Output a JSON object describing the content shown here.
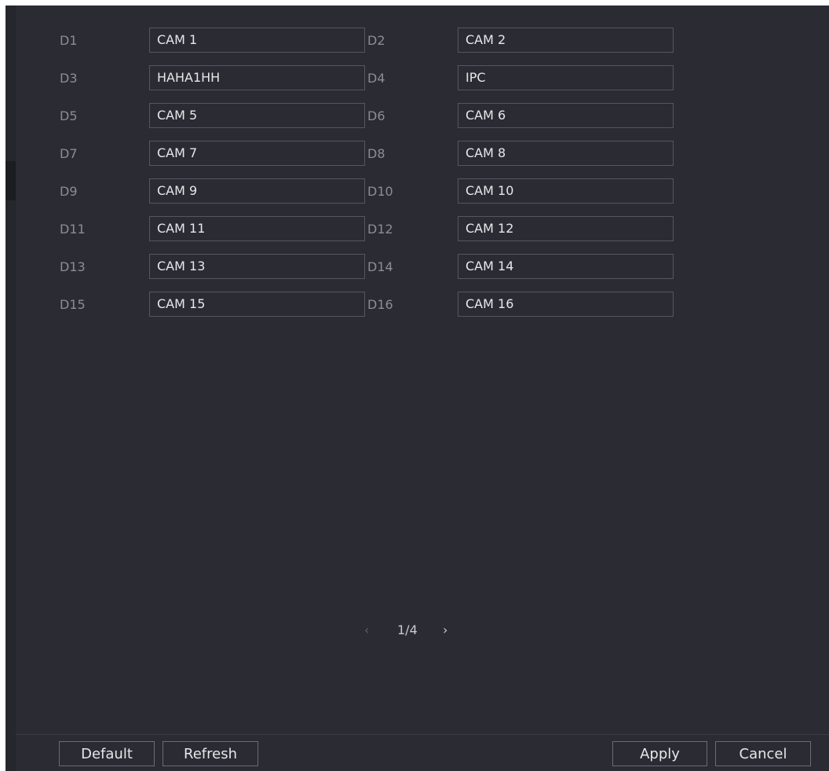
{
  "channels": {
    "left": [
      {
        "label": "D1",
        "name": "CAM 1"
      },
      {
        "label": "D3",
        "name": "HAHA1HH"
      },
      {
        "label": "D5",
        "name": "CAM 5"
      },
      {
        "label": "D7",
        "name": "CAM 7"
      },
      {
        "label": "D9",
        "name": "CAM 9"
      },
      {
        "label": "D11",
        "name": "CAM 11"
      },
      {
        "label": "D13",
        "name": "CAM 13"
      },
      {
        "label": "D15",
        "name": "CAM 15"
      }
    ],
    "right": [
      {
        "label": "D2",
        "name": "CAM 2"
      },
      {
        "label": "D4",
        "name": "IPC"
      },
      {
        "label": "D6",
        "name": "CAM 6"
      },
      {
        "label": "D8",
        "name": "CAM 8"
      },
      {
        "label": "D10",
        "name": "CAM 10"
      },
      {
        "label": "D12",
        "name": "CAM 12"
      },
      {
        "label": "D14",
        "name": "CAM 14"
      },
      {
        "label": "D16",
        "name": "CAM 16"
      }
    ]
  },
  "pagination": {
    "prev_icon": "‹",
    "page": "1/4",
    "next_icon": "›"
  },
  "buttons": {
    "default_label": "Default",
    "refresh_label": "Refresh",
    "apply_label": "Apply",
    "cancel_label": "Cancel"
  },
  "colors": {
    "panel_bg": "#2b2c33",
    "label_text": "#8b8d94",
    "input_text": "#e6e7ea",
    "input_border": "#55575e"
  }
}
